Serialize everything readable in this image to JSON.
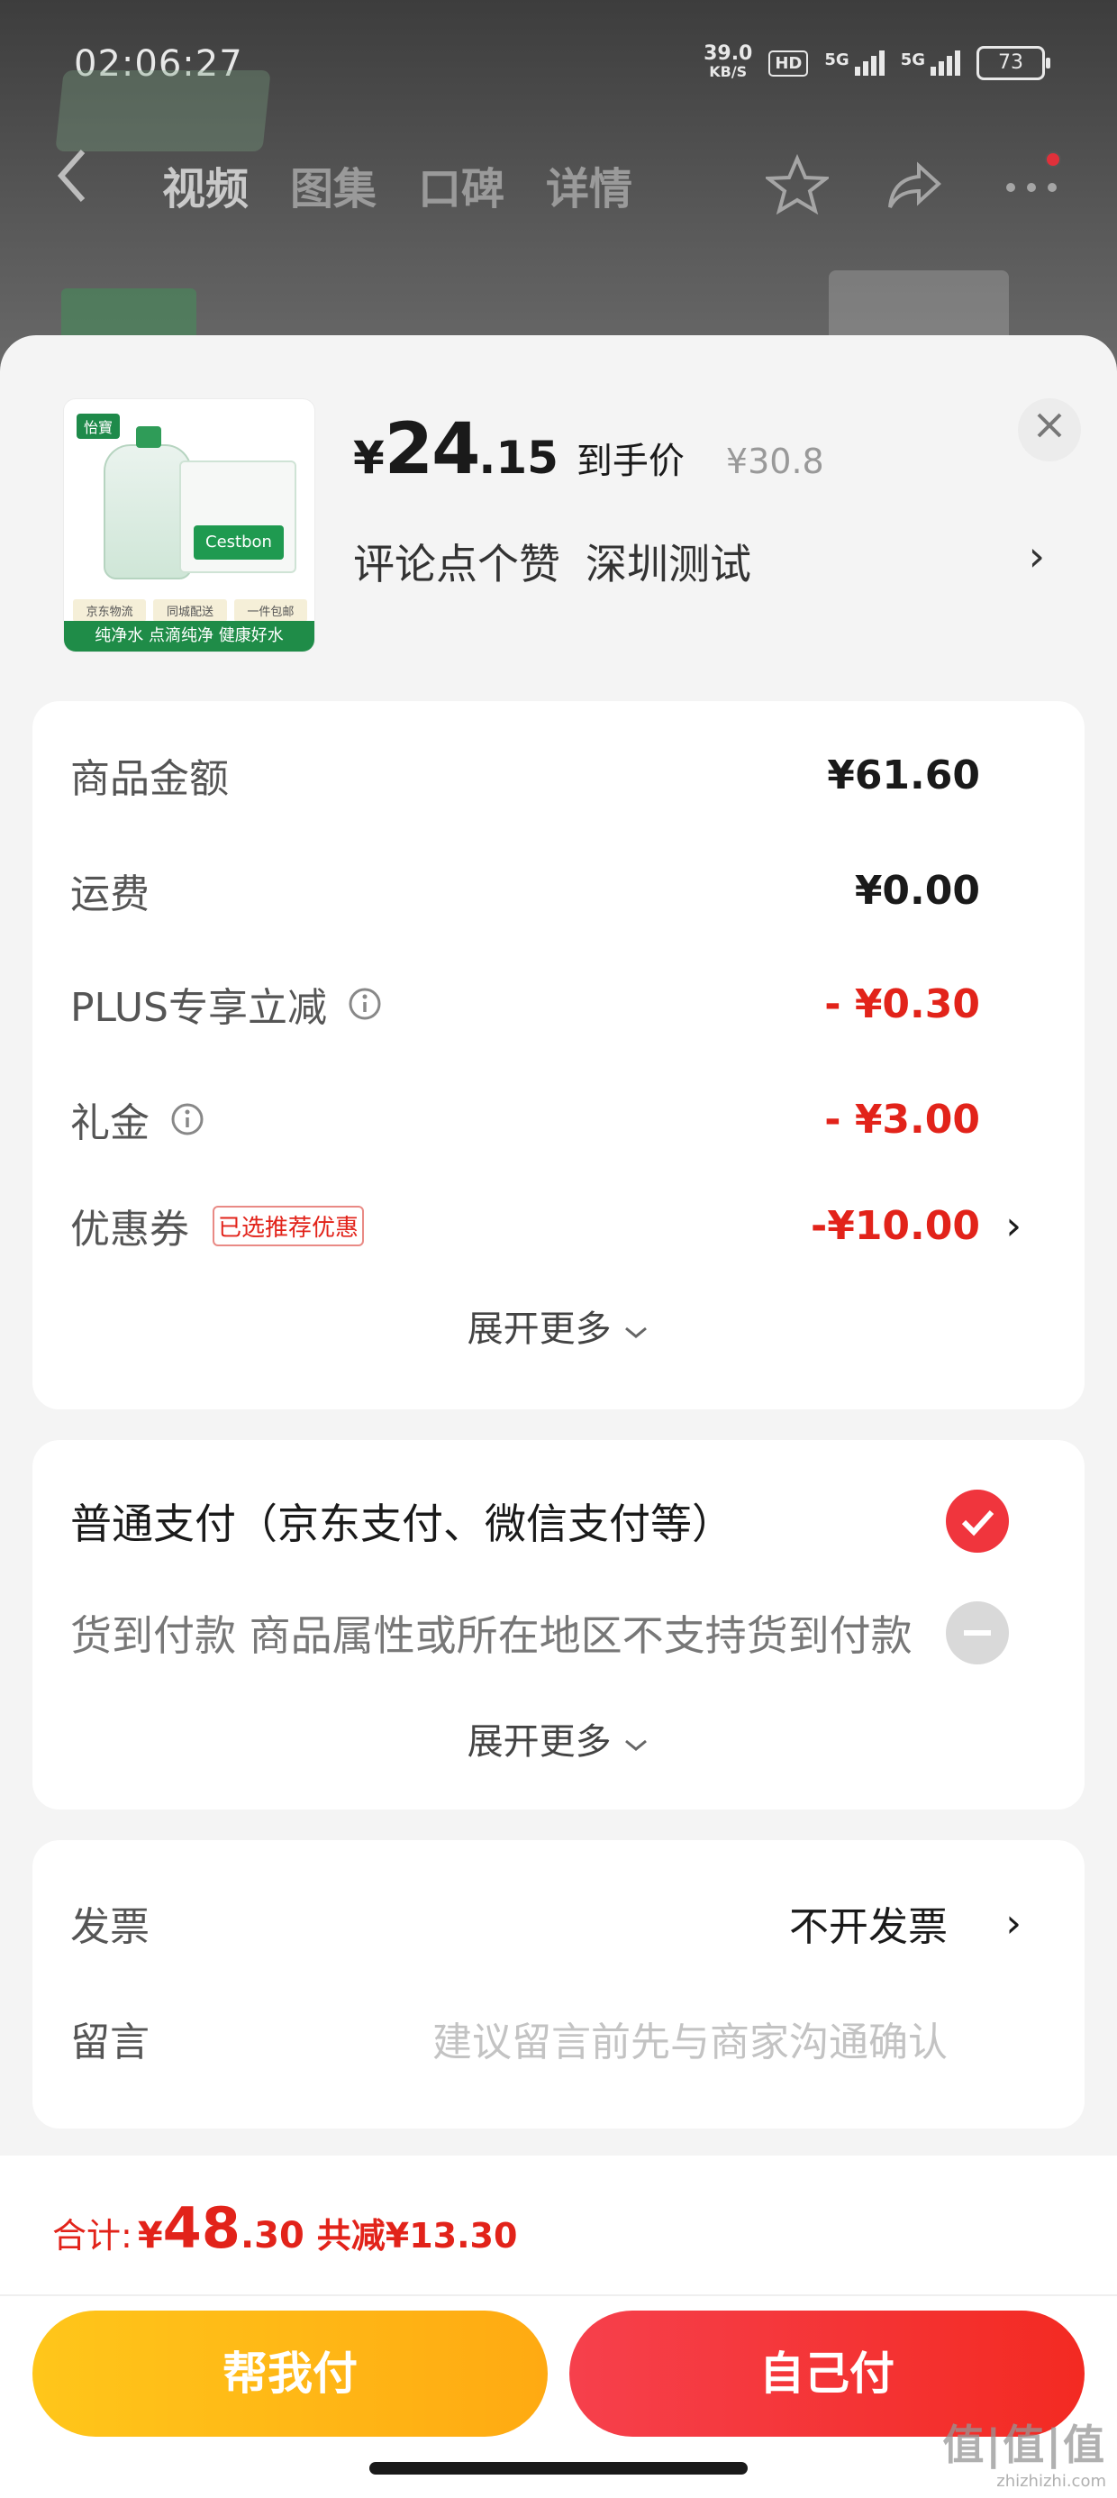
{
  "status_bar": {
    "time": "02:06:27",
    "net_speed_value": "39.0",
    "net_speed_unit": "KB/S",
    "hd": "HD",
    "signal1": "5G",
    "signal2": "5G",
    "battery": "73"
  },
  "nav": {
    "tabs": [
      "视频",
      "图集",
      "口碑",
      "详情"
    ]
  },
  "product": {
    "thumb_brand": "怡寶",
    "thumb_box_label": "Cestbon",
    "thumb_tags": [
      "京东物流",
      "同城配送",
      "一件包邮"
    ],
    "thumb_band": "纯净水 点滴纯净 健康好水",
    "price_symbol": "¥",
    "price_int": "24",
    "price_dec": ".15",
    "price_tag": "到手价",
    "original_price": "¥30.8",
    "sub_left": "评论点个赞",
    "sub_right": "深圳测试"
  },
  "cost_breakdown": {
    "rows": [
      {
        "label": "商品金额",
        "value": "¥61.60"
      },
      {
        "label": "运费",
        "value": "¥0.00"
      },
      {
        "label": "PLUS专享立减",
        "value": "- ¥0.30"
      },
      {
        "label": "礼金",
        "value": "- ¥3.00"
      },
      {
        "label": "优惠券",
        "badge": "已选推荐优惠",
        "value": "-¥10.00"
      }
    ],
    "expand_label": "展开更多"
  },
  "payment": {
    "normal": "普通支付（京东支付、微信支付等）",
    "cod": "货到付款 商品属性或所在地区不支持货到付款",
    "expand_label": "展开更多"
  },
  "extras": {
    "invoice_label": "发票",
    "invoice_value": "不开发票",
    "note_label": "留言",
    "note_placeholder": "建议留言前先与商家沟通确认"
  },
  "summary": {
    "total_label": "合计:",
    "total_symbol": "¥",
    "total_int": "48",
    "total_dec": ".30",
    "saved": "共减¥13.30"
  },
  "buttons": {
    "help_pay": "帮我付",
    "self_pay": "自己付"
  },
  "watermark": {
    "big": "值|值|值",
    "small": "zhizhizhi.com"
  },
  "colors": {
    "accent_red": "#e2231a",
    "help_yellow": "#ffb915"
  }
}
